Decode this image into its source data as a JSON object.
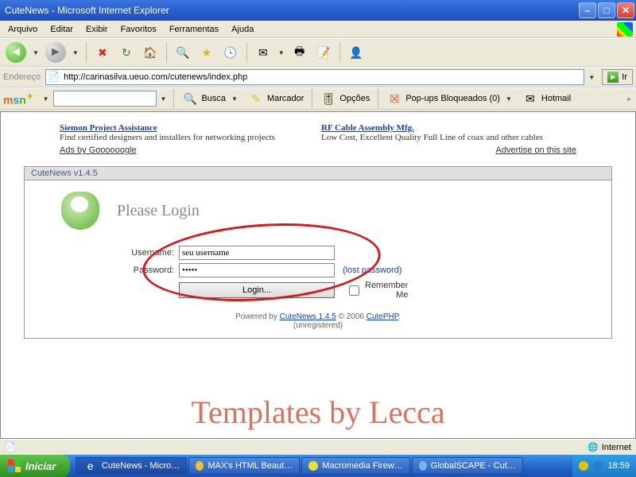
{
  "window": {
    "title": "CuteNews - Microsoft Internet Explorer"
  },
  "menu": {
    "items": [
      "Arquivo",
      "Editar",
      "Exibir",
      "Favoritos",
      "Ferramentas",
      "Ajuda"
    ]
  },
  "address": {
    "label": "Endereço",
    "url": "http://carinasilva.ueuo.com/cutenews/index.php",
    "go_label": "Ir"
  },
  "msn_toolbar": {
    "search_value": "",
    "busca": "Busca",
    "marcador": "Marcador",
    "opcoes": "Opções",
    "popups": "Pop-ups Bloqueados (0)",
    "hotmail": "Hotmail"
  },
  "ads": {
    "left": {
      "title": "Siemon Project Assistance",
      "body": "Find certified designers and installers for networking projects"
    },
    "right": {
      "title": "RF Cable Assembly Mfg.",
      "body": "Low Cost, Excellent Quality Full Line of coax and other cables"
    },
    "by": "Ads by Goooooogle",
    "advertise": "Advertise on this site"
  },
  "panel": {
    "heading": "CuteNews v1.4.5",
    "login_title": "Please Login",
    "username_label": "Username:",
    "username_value": "seu username",
    "password_label": "Password:",
    "password_value": "•••••",
    "lost_password": "(lost password)",
    "login_button": "Login...",
    "remember": "Remember Me"
  },
  "footer": {
    "powered_prefix": "Powered by ",
    "cutenews": "CuteNews 1.4.5",
    "copyright": " © 2006 ",
    "cutephp": "CutePHP",
    "unreg": "(unregistered)"
  },
  "watermark": "Templates by Lecca",
  "status": {
    "zone": "Internet"
  },
  "taskbar": {
    "start": "Iniciar",
    "items": [
      "CuteNews - Micro…",
      "MAX's HTML Beaut…",
      "Macromedia Firew…",
      "GlobalSCAPE - Cut…"
    ],
    "clock": "18:59"
  }
}
